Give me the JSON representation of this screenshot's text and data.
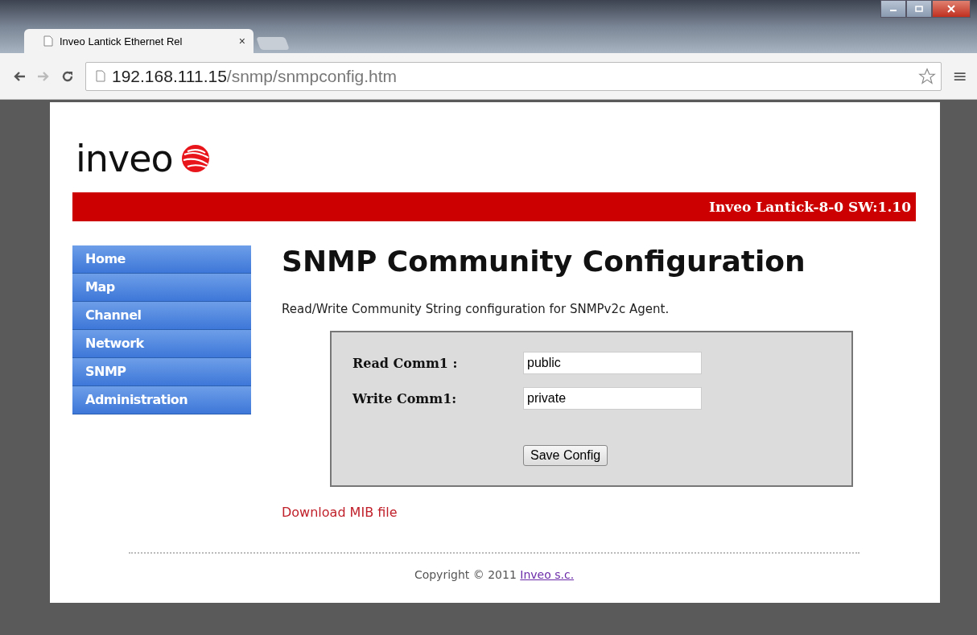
{
  "browser": {
    "tab_title": "Inveo Lantick Ethernet Rel",
    "tab_close": "×",
    "address_host": "192.168.111.15",
    "address_path": "/snmp/snmpconfig.htm",
    "menu_glyph": "≡"
  },
  "header": {
    "logo_text": "inveo",
    "device_info": "Inveo Lantick-8-0 SW:1.10"
  },
  "sidebar": {
    "items": [
      {
        "label": "Home"
      },
      {
        "label": "Map"
      },
      {
        "label": "Channel"
      },
      {
        "label": "Network"
      },
      {
        "label": "SNMP"
      },
      {
        "label": "Administration"
      }
    ]
  },
  "content": {
    "title": "SNMP Community Configuration",
    "description": "Read/Write Community String configuration for SNMPv2c Agent.",
    "fields": [
      {
        "label": "Read Comm1 :",
        "value": "public"
      },
      {
        "label": "Write Comm1:",
        "value": "private"
      }
    ],
    "save_button": "Save Config",
    "download_link": "Download MIB file"
  },
  "footer": {
    "copyright": "Copyright © 2011",
    "company_link": "Inveo s.c."
  }
}
